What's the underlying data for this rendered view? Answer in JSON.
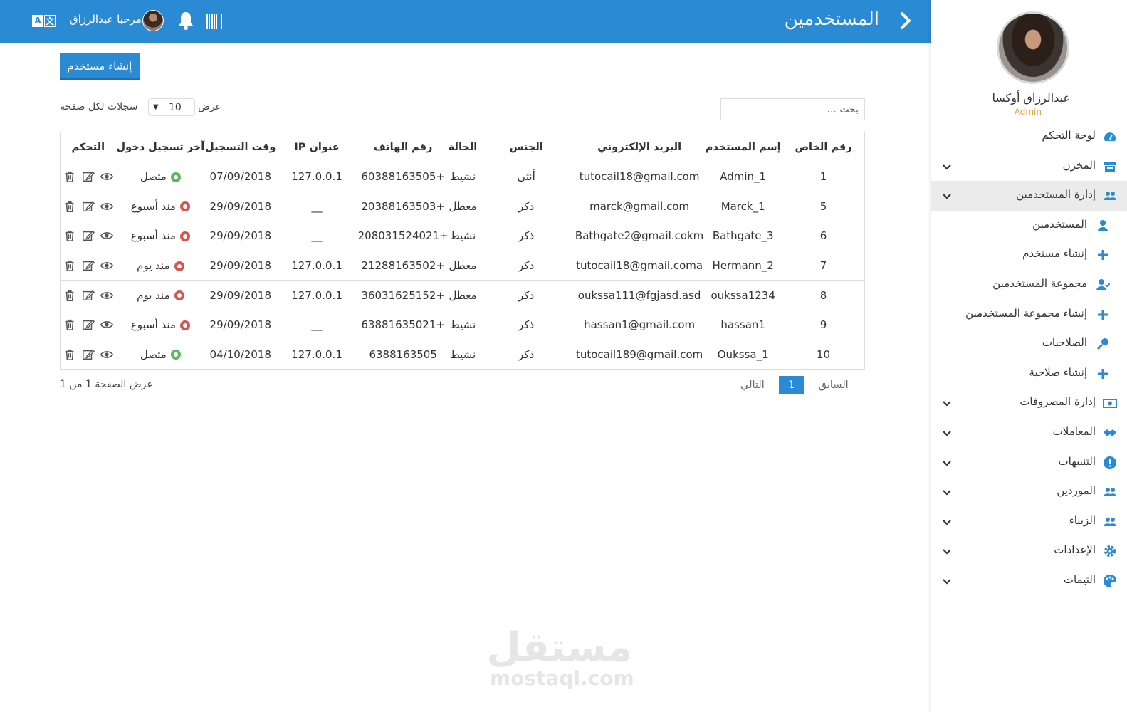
{
  "header": {
    "page_title": "المستخدمين",
    "greeting": "مرحبا عبدالرزاق",
    "brand_color": "#2a8ad3"
  },
  "profile": {
    "name": "عبدالرزاق أوكسا",
    "role": "Admin"
  },
  "sidebar": {
    "items": [
      {
        "label": "لوحة التحكم",
        "icon": "dashboard-icon"
      },
      {
        "label": "المخزن",
        "icon": "store-icon",
        "has_caret": true
      },
      {
        "label": "إدارة المستخدمين",
        "icon": "users-icon",
        "has_caret": true,
        "active": true
      },
      {
        "label": "المستخدمين",
        "icon": "user-icon",
        "sub": true
      },
      {
        "label": "إنشاء مستخدم",
        "icon": "plus-icon",
        "sub": true
      },
      {
        "label": "مجموعة المستخدمين",
        "icon": "user-group-icon",
        "sub": true
      },
      {
        "label": "إنشاء مجموعة المستخدمين",
        "icon": "plus-icon",
        "sub": true
      },
      {
        "label": "الصلاحيات",
        "icon": "key-icon",
        "sub": true
      },
      {
        "label": "إنشاء صلاحية",
        "icon": "plus-icon",
        "sub": true
      },
      {
        "label": "إدارة المصروفات",
        "icon": "money-icon",
        "has_caret": true
      },
      {
        "label": "المعاملات",
        "icon": "handshake-icon",
        "has_caret": true
      },
      {
        "label": "التنبيهات",
        "icon": "alert-icon",
        "has_caret": true
      },
      {
        "label": "الموردين",
        "icon": "users-icon",
        "has_caret": true
      },
      {
        "label": "الزبناء",
        "icon": "users-icon",
        "has_caret": true
      },
      {
        "label": "الإعدادات",
        "icon": "gear-icon",
        "has_caret": true
      },
      {
        "label": "التيمات",
        "icon": "palette-icon",
        "has_caret": true
      }
    ]
  },
  "toolbar": {
    "create_label": "إنشاء مستخدم",
    "length_before": "سجلات لكل صفحة",
    "length_value": "10",
    "length_after": "عرض",
    "search_placeholder": "بحث ..."
  },
  "table": {
    "headers": [
      "رقم الخاص",
      "إسم المستخدم",
      "البريد الإلكتروني",
      "الجنس",
      "الحالة",
      "رقم الهاتف",
      "عنوان IP",
      "وقت التسجيل",
      "آخر تسجيل دخول",
      "التحكم"
    ],
    "rows": [
      {
        "id": "1",
        "username": "Admin_1",
        "email": "tutocail18@gmail.com",
        "gender": "أنثى",
        "status": "نشيط",
        "phone": "60388163505+",
        "ip": "127.0.0.1",
        "registered": "07/09/2018",
        "last_login": "متصل",
        "online": true
      },
      {
        "id": "5",
        "username": "Marck_1",
        "email": "marck@gmail.com",
        "gender": "ذكر",
        "status": "معطل",
        "phone": "20388163503+",
        "ip": "__",
        "registered": "29/09/2018",
        "last_login": "مند أسبوع",
        "online": false
      },
      {
        "id": "6",
        "username": "Bathgate_3",
        "email": "Bathgate2@gmail.cokm",
        "gender": "ذكر",
        "status": "نشيط",
        "phone": "208031524021+",
        "ip": "__",
        "registered": "29/09/2018",
        "last_login": "مند أسبوع",
        "online": false
      },
      {
        "id": "7",
        "username": "Hermann_2",
        "email": "tutocail18@gmail.coma",
        "gender": "ذكر",
        "status": "معطل",
        "phone": "21288163502+",
        "ip": "127.0.0.1",
        "registered": "29/09/2018",
        "last_login": "مند يوم",
        "online": false
      },
      {
        "id": "8",
        "username": "oukssa1234",
        "email": "oukssa111@fgjasd.asd",
        "gender": "ذكر",
        "status": "معطل",
        "phone": "36031625152+",
        "ip": "127.0.0.1",
        "registered": "29/09/2018",
        "last_login": "مند يوم",
        "online": false
      },
      {
        "id": "9",
        "username": "hassan1",
        "email": "hassan1@gmail.com",
        "gender": "ذكر",
        "status": "نشيط",
        "phone": "63881635021+",
        "ip": "__",
        "registered": "29/09/2018",
        "last_login": "مند أسبوع",
        "online": false
      },
      {
        "id": "10",
        "username": "Oukssa_1",
        "email": "tutocail189@gmail.com",
        "gender": "ذكر",
        "status": "نشيط",
        "phone": "6388163505",
        "ip": "127.0.0.1",
        "registered": "04/10/2018",
        "last_login": "متصل",
        "online": true
      }
    ]
  },
  "footer": {
    "info": "عرض الصفحة 1 من 1",
    "prev": "السابق",
    "page": "1",
    "next": "التالي"
  },
  "watermark": {
    "ar": "مستقل",
    "en": "mostaql.com"
  }
}
